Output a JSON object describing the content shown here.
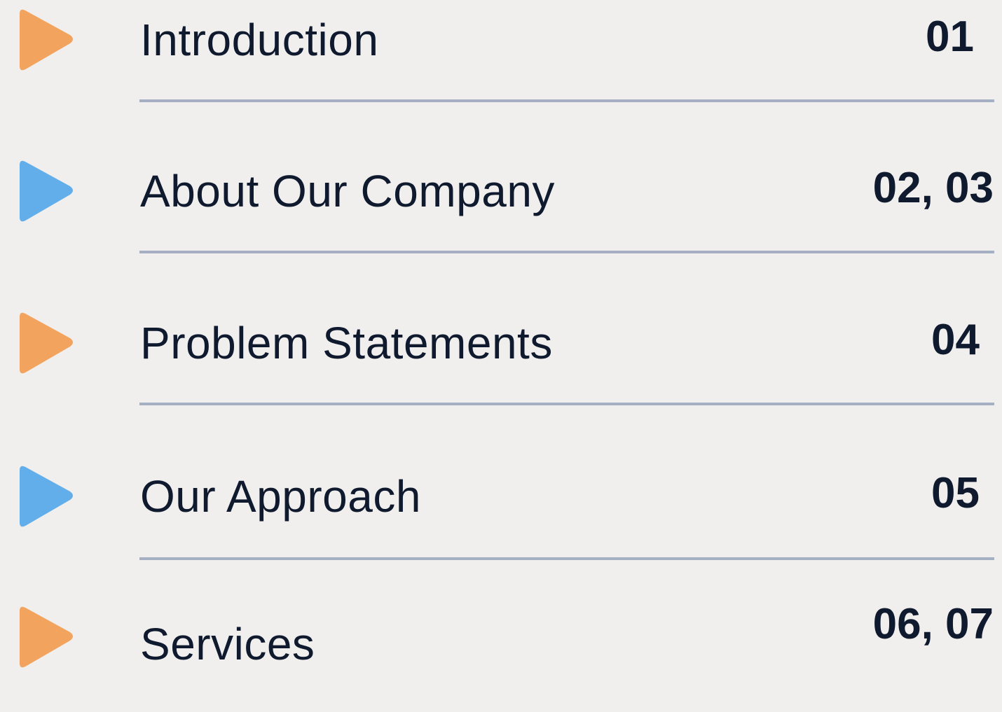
{
  "colors": {
    "background": "#f0efed",
    "text": "#0f1a2e",
    "divider": "#a5b1c3",
    "orange_marker": "#f2a35e",
    "blue_marker": "#62aeea"
  },
  "toc": {
    "items": [
      {
        "label": "Introduction",
        "page": "01",
        "icon": "play-triangle-icon",
        "icon_color": "#f2a35e"
      },
      {
        "label": "About Our Company",
        "page": "02, 03",
        "icon": "play-triangle-icon",
        "icon_color": "#62aeea"
      },
      {
        "label": "Problem Statements",
        "page": "04",
        "icon": "play-triangle-icon",
        "icon_color": "#f2a35e"
      },
      {
        "label": "Our Approach",
        "page": "05",
        "icon": "play-triangle-icon",
        "icon_color": "#62aeea"
      },
      {
        "label": "Services",
        "page": "06, 07",
        "icon": "play-triangle-icon",
        "icon_color": "#f2a35e"
      }
    ]
  }
}
